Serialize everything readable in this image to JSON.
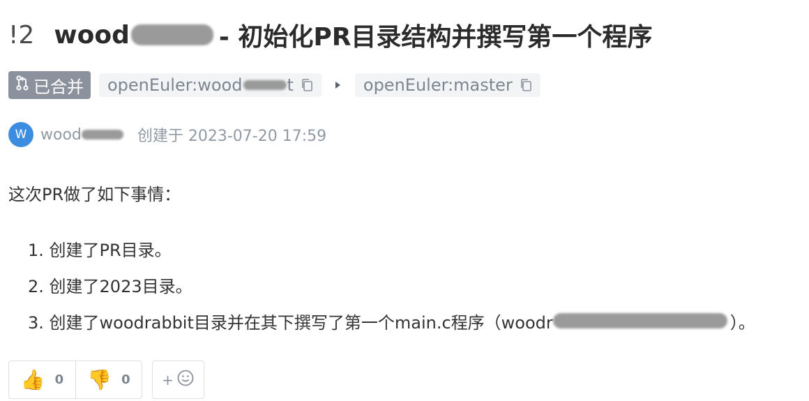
{
  "header": {
    "pr_number": "!2",
    "title_prefix": "wood",
    "title_suffix": "- 初始化PR目录结构并撰写第一个程序"
  },
  "branches": {
    "status": "已合并",
    "source_prefix": "openEuler:wood",
    "source_tail": "t",
    "target": "openEuler:master"
  },
  "author": {
    "avatar_letter": "W",
    "name_prefix": "wood",
    "created_text": "创建于 2023-07-20 17:59"
  },
  "description": {
    "intro": "这次PR做了如下事情：",
    "items": [
      "1. 创建了PR目录。",
      "2. 创建了2023目录。",
      "3. 创建了woodrabbit目录并在其下撰写了第一个main.c程序（woodr"
    ],
    "item3_suffix": "）。"
  },
  "reactions": {
    "thumbs_up_count": "0",
    "thumbs_down_count": "0",
    "add_label": "+"
  },
  "colors": {
    "badge": "#8c929d",
    "chip_bg": "#f2f4f6",
    "avatar": "#3c8de0"
  }
}
